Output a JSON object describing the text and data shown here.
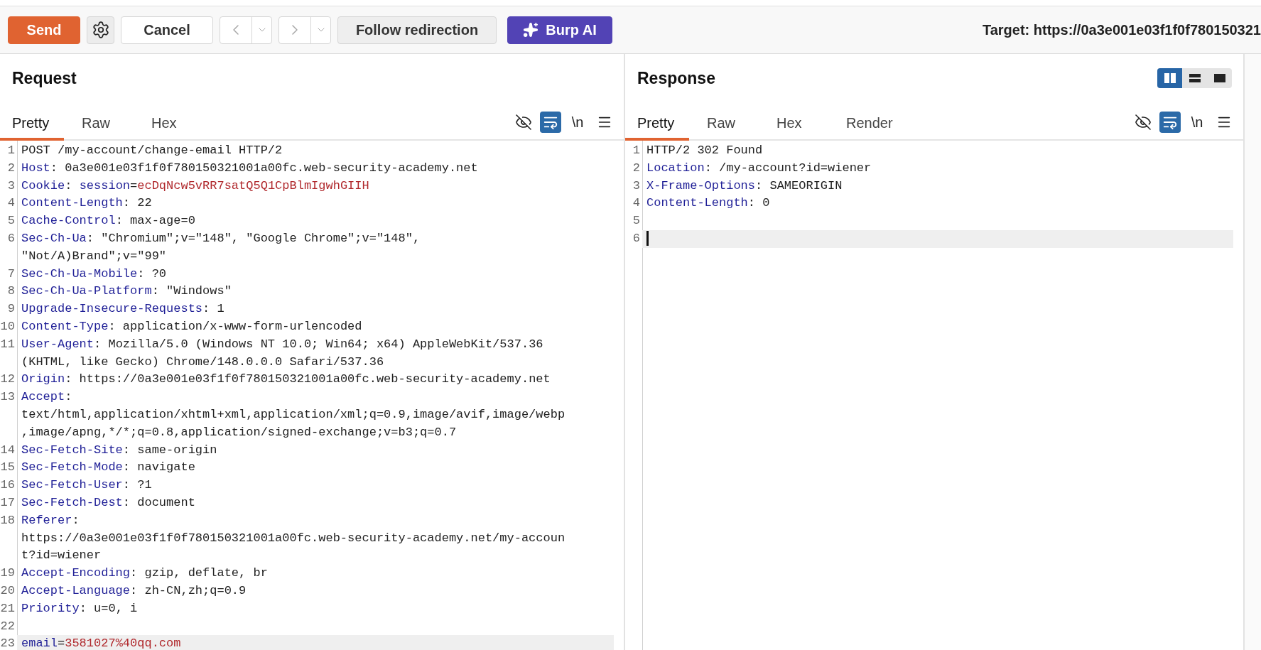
{
  "toolbar": {
    "buttons": [
      {
        "kind": "send",
        "label": "Send",
        "disabled": false
      },
      {
        "kind": "settings",
        "disabled": false
      },
      {
        "kind": "cancel",
        "label": "Cancel",
        "disabled": false
      },
      {
        "kind": "back",
        "disabled": true
      },
      {
        "kind": "forward",
        "disabled": true
      },
      {
        "kind": "follow",
        "label": "Follow redirection",
        "disabled": false
      },
      {
        "kind": "ai",
        "label": "Burp AI",
        "disabled": false
      }
    ],
    "target": "Target: https://0a3e001e03f1f0f780150321"
  },
  "panes": [
    {
      "title": "Request",
      "tabs": [
        {
          "label": "Pretty",
          "selected": true
        },
        {
          "label": "Raw",
          "selected": false
        },
        {
          "label": "Hex",
          "selected": false
        }
      ],
      "tools": [
        {
          "kind": "hide",
          "on": false
        },
        {
          "kind": "wrap",
          "on": true
        },
        {
          "kind": "newline",
          "label": "\\n",
          "on": false
        },
        {
          "kind": "menu",
          "on": false
        }
      ],
      "lines": [
        {
          "number": "1",
          "segments": [
            {
              "kind": "plain",
              "text": "POST /my-account/change-email HTTP/2"
            }
          ],
          "highlighted": false,
          "cursor": false
        },
        {
          "number": "2",
          "segments": [
            {
              "kind": "name",
              "text": "Host"
            },
            {
              "kind": "plain",
              "text": ": 0a3e001e03f1f0f780150321001a00fc.web-security-academy.net"
            }
          ],
          "highlighted": false,
          "cursor": false
        },
        {
          "number": "3",
          "segments": [
            {
              "kind": "name",
              "text": "Cookie"
            },
            {
              "kind": "plain",
              "text": ": "
            },
            {
              "kind": "name",
              "text": "session"
            },
            {
              "kind": "plain",
              "text": "="
            },
            {
              "kind": "value",
              "text": "ecDqNcw5vRR7satQ5Q1CpBlmIgwhGIIH"
            }
          ],
          "highlighted": false,
          "cursor": false
        },
        {
          "number": "4",
          "segments": [
            {
              "kind": "name",
              "text": "Content-Length"
            },
            {
              "kind": "plain",
              "text": ": 22"
            }
          ],
          "highlighted": false,
          "cursor": false
        },
        {
          "number": "5",
          "segments": [
            {
              "kind": "name",
              "text": "Cache-Control"
            },
            {
              "kind": "plain",
              "text": ": max-age=0"
            }
          ],
          "highlighted": false,
          "cursor": false
        },
        {
          "number": "6",
          "segments": [
            {
              "kind": "name",
              "text": "Sec-Ch-Ua"
            },
            {
              "kind": "plain",
              "text": ": \"Chromium\";v=\"148\", \"Google Chrome\";v=\"148\","
            }
          ],
          "wrapped": [
            "\"Not/A)Brand\";v=\"99\""
          ],
          "highlighted": false,
          "cursor": false
        },
        {
          "number": "7",
          "segments": [
            {
              "kind": "name",
              "text": "Sec-Ch-Ua-Mobile"
            },
            {
              "kind": "plain",
              "text": ": ?0"
            }
          ],
          "highlighted": false,
          "cursor": false
        },
        {
          "number": "8",
          "segments": [
            {
              "kind": "name",
              "text": "Sec-Ch-Ua-Platform"
            },
            {
              "kind": "plain",
              "text": ": \"Windows\""
            }
          ],
          "highlighted": false,
          "cursor": false
        },
        {
          "number": "9",
          "segments": [
            {
              "kind": "name",
              "text": "Upgrade-Insecure-Requests"
            },
            {
              "kind": "plain",
              "text": ": 1"
            }
          ],
          "highlighted": false,
          "cursor": false
        },
        {
          "number": "10",
          "segments": [
            {
              "kind": "name",
              "text": "Content-Type"
            },
            {
              "kind": "plain",
              "text": ": application/x-www-form-urlencoded"
            }
          ],
          "highlighted": false,
          "cursor": false
        },
        {
          "number": "11",
          "segments": [
            {
              "kind": "name",
              "text": "User-Agent"
            },
            {
              "kind": "plain",
              "text": ": Mozilla/5.0 (Windows NT 10.0; Win64; x64) AppleWebKit/537.36"
            }
          ],
          "wrapped": [
            "(KHTML, like Gecko) Chrome/148.0.0.0 Safari/537.36"
          ],
          "highlighted": false,
          "cursor": false
        },
        {
          "number": "12",
          "segments": [
            {
              "kind": "name",
              "text": "Origin"
            },
            {
              "kind": "plain",
              "text": ": https://0a3e001e03f1f0f780150321001a00fc.web-security-academy.net"
            }
          ],
          "highlighted": false,
          "cursor": false
        },
        {
          "number": "13",
          "segments": [
            {
              "kind": "name",
              "text": "Accept"
            },
            {
              "kind": "plain",
              "text": ":"
            }
          ],
          "wrapped": [
            "text/html,application/xhtml+xml,application/xml;q=0.9,image/avif,image/webp",
            ",image/apng,*/*;q=0.8,application/signed-exchange;v=b3;q=0.7"
          ],
          "highlighted": false,
          "cursor": false
        },
        {
          "number": "14",
          "segments": [
            {
              "kind": "name",
              "text": "Sec-Fetch-Site"
            },
            {
              "kind": "plain",
              "text": ": same-origin"
            }
          ],
          "highlighted": false,
          "cursor": false
        },
        {
          "number": "15",
          "segments": [
            {
              "kind": "name",
              "text": "Sec-Fetch-Mode"
            },
            {
              "kind": "plain",
              "text": ": navigate"
            }
          ],
          "highlighted": false,
          "cursor": false
        },
        {
          "number": "16",
          "segments": [
            {
              "kind": "name",
              "text": "Sec-Fetch-User"
            },
            {
              "kind": "plain",
              "text": ": ?1"
            }
          ],
          "highlighted": false,
          "cursor": false
        },
        {
          "number": "17",
          "segments": [
            {
              "kind": "name",
              "text": "Sec-Fetch-Dest"
            },
            {
              "kind": "plain",
              "text": ": document"
            }
          ],
          "highlighted": false,
          "cursor": false
        },
        {
          "number": "18",
          "segments": [
            {
              "kind": "name",
              "text": "Referer"
            },
            {
              "kind": "plain",
              "text": ":"
            }
          ],
          "wrapped": [
            "https://0a3e001e03f1f0f780150321001a00fc.web-security-academy.net/my-accoun",
            "t?id=wiener"
          ],
          "highlighted": false,
          "cursor": false
        },
        {
          "number": "19",
          "segments": [
            {
              "kind": "name",
              "text": "Accept-Encoding"
            },
            {
              "kind": "plain",
              "text": ": gzip, deflate, br"
            }
          ],
          "highlighted": false,
          "cursor": false
        },
        {
          "number": "20",
          "segments": [
            {
              "kind": "name",
              "text": "Accept-Language"
            },
            {
              "kind": "plain",
              "text": ": zh-CN,zh;q=0.9"
            }
          ],
          "highlighted": false,
          "cursor": false
        },
        {
          "number": "21",
          "segments": [
            {
              "kind": "name",
              "text": "Priority"
            },
            {
              "kind": "plain",
              "text": ": u=0, i"
            }
          ],
          "highlighted": false,
          "cursor": false
        },
        {
          "number": "22",
          "highlighted": false,
          "cursor": false
        },
        {
          "number": "23",
          "segments": [
            {
              "kind": "name",
              "text": "email"
            },
            {
              "kind": "plain",
              "text": "="
            },
            {
              "kind": "value",
              "text": "3581027%40qq.com"
            }
          ],
          "highlighted": true,
          "cursor": false
        }
      ]
    },
    {
      "title": "Response",
      "layouts": [
        {
          "kind": "columns",
          "selected": true
        },
        {
          "kind": "rows",
          "selected": false
        },
        {
          "kind": "single",
          "selected": false
        }
      ],
      "tabs": [
        {
          "label": "Pretty",
          "selected": true
        },
        {
          "label": "Raw",
          "selected": false
        },
        {
          "label": "Hex",
          "selected": false
        },
        {
          "label": "Render",
          "selected": false
        }
      ],
      "tools": [
        {
          "kind": "hide",
          "on": false
        },
        {
          "kind": "wrap",
          "on": true
        },
        {
          "kind": "newline",
          "label": "\\n",
          "on": false
        },
        {
          "kind": "menu",
          "on": false
        }
      ],
      "lines": [
        {
          "number": "1",
          "segments": [
            {
              "kind": "plain",
              "text": "HTTP/2 302 Found"
            }
          ],
          "highlighted": false,
          "cursor": false
        },
        {
          "number": "2",
          "segments": [
            {
              "kind": "name",
              "text": "Location"
            },
            {
              "kind": "plain",
              "text": ": /my-account?id=wiener"
            }
          ],
          "highlighted": false,
          "cursor": false
        },
        {
          "number": "3",
          "segments": [
            {
              "kind": "name",
              "text": "X-Frame-Options"
            },
            {
              "kind": "plain",
              "text": ": SAMEORIGIN"
            }
          ],
          "highlighted": false,
          "cursor": false
        },
        {
          "number": "4",
          "segments": [
            {
              "kind": "name",
              "text": "Content-Length"
            },
            {
              "kind": "plain",
              "text": ": 0"
            }
          ],
          "highlighted": false,
          "cursor": false
        },
        {
          "number": "5",
          "highlighted": false,
          "cursor": false
        },
        {
          "number": "6",
          "highlighted": true,
          "cursor": true
        }
      ]
    }
  ]
}
